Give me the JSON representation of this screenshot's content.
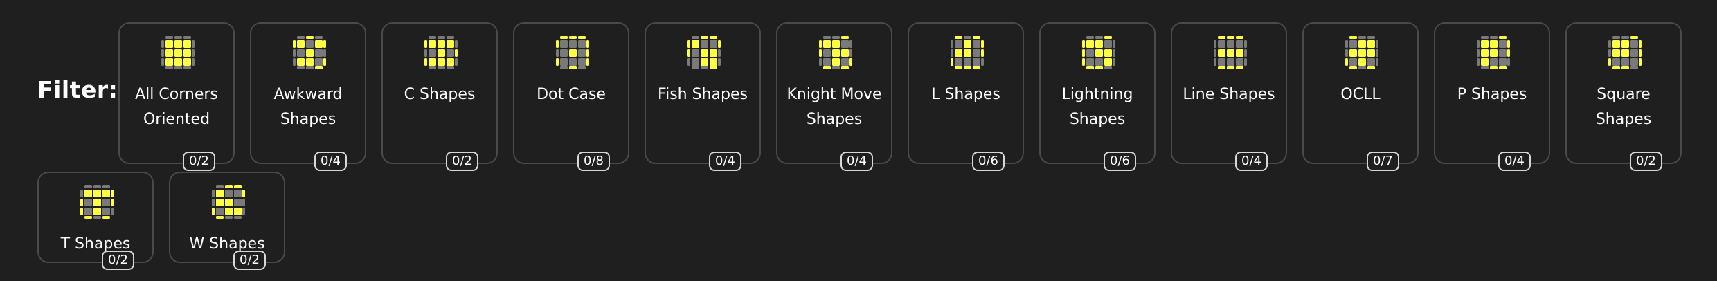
{
  "filter_label": "Filter:",
  "colors": {
    "top": "#ffff44",
    "off": "#7a7a7a",
    "background": "#1f1f1f"
  },
  "cards": [
    {
      "label": "All Corners Oriented",
      "count": "0/2",
      "top": [
        1,
        1,
        1,
        1,
        1,
        1,
        1,
        1,
        1
      ],
      "sides": {
        "t": [
          0,
          0,
          0
        ],
        "r": [
          0,
          0,
          0
        ],
        "b": [
          0,
          0,
          0
        ],
        "l": [
          0,
          0,
          0
        ]
      }
    },
    {
      "label": "Awkward Shapes",
      "count": "0/4",
      "top": [
        1,
        0,
        1,
        0,
        1,
        0,
        1,
        1,
        0
      ],
      "sides": {
        "t": [
          0,
          1,
          0
        ],
        "r": [
          1,
          0,
          1
        ],
        "b": [
          0,
          0,
          1
        ],
        "l": [
          1,
          0,
          0
        ]
      }
    },
    {
      "label": "C Shapes",
      "count": "0/2",
      "top": [
        1,
        1,
        1,
        0,
        1,
        0,
        1,
        1,
        1
      ],
      "sides": {
        "t": [
          0,
          0,
          0
        ],
        "r": [
          0,
          1,
          0
        ],
        "b": [
          0,
          0,
          0
        ],
        "l": [
          1,
          0,
          1
        ]
      }
    },
    {
      "label": "Dot Case",
      "count": "0/8",
      "top": [
        0,
        0,
        0,
        0,
        1,
        0,
        0,
        0,
        0
      ],
      "sides": {
        "t": [
          1,
          1,
          1
        ],
        "r": [
          1,
          1,
          1
        ],
        "b": [
          0,
          1,
          0
        ],
        "l": [
          1,
          0,
          1
        ]
      }
    },
    {
      "label": "Fish Shapes",
      "count": "0/4",
      "top": [
        1,
        0,
        0,
        0,
        1,
        1,
        0,
        1,
        1
      ],
      "sides": {
        "t": [
          0,
          1,
          1
        ],
        "r": [
          1,
          0,
          0
        ],
        "b": [
          0,
          0,
          1
        ],
        "l": [
          1,
          1,
          0
        ]
      }
    },
    {
      "label": "Knight Move Shapes",
      "count": "0/4",
      "top": [
        1,
        1,
        0,
        0,
        1,
        1,
        0,
        1,
        0
      ],
      "sides": {
        "t": [
          0,
          0,
          1
        ],
        "r": [
          0,
          0,
          1
        ],
        "b": [
          1,
          0,
          1
        ],
        "l": [
          1,
          1,
          0
        ]
      }
    },
    {
      "label": "L Shapes",
      "count": "0/6",
      "top": [
        0,
        1,
        0,
        1,
        1,
        0,
        0,
        0,
        0
      ],
      "sides": {
        "t": [
          1,
          0,
          1
        ],
        "r": [
          1,
          1,
          0
        ],
        "b": [
          1,
          1,
          1
        ],
        "l": [
          0,
          0,
          1
        ]
      }
    },
    {
      "label": "Lightning Shapes",
      "count": "0/6",
      "top": [
        1,
        1,
        0,
        0,
        1,
        1,
        0,
        0,
        1
      ],
      "sides": {
        "t": [
          0,
          0,
          1
        ],
        "r": [
          0,
          0,
          0
        ],
        "b": [
          1,
          1,
          0
        ],
        "l": [
          1,
          1,
          1
        ]
      }
    },
    {
      "label": "Line Shapes",
      "count": "0/4",
      "top": [
        0,
        0,
        0,
        1,
        1,
        1,
        0,
        0,
        0
      ],
      "sides": {
        "t": [
          1,
          1,
          1
        ],
        "r": [
          0,
          0,
          0
        ],
        "b": [
          1,
          1,
          1
        ],
        "l": [
          0,
          0,
          0
        ]
      }
    },
    {
      "label": "OCLL",
      "count": "0/7",
      "top": [
        0,
        1,
        1,
        1,
        1,
        1,
        0,
        1,
        0
      ],
      "sides": {
        "t": [
          1,
          0,
          0
        ],
        "r": [
          0,
          0,
          0
        ],
        "b": [
          1,
          0,
          1
        ],
        "l": [
          0,
          0,
          1
        ]
      }
    },
    {
      "label": "P Shapes",
      "count": "0/4",
      "top": [
        1,
        1,
        0,
        1,
        1,
        0,
        1,
        0,
        0
      ],
      "sides": {
        "t": [
          0,
          0,
          1
        ],
        "r": [
          1,
          1,
          0
        ],
        "b": [
          0,
          1,
          1
        ],
        "l": [
          0,
          0,
          0
        ]
      }
    },
    {
      "label": "Square Shapes",
      "count": "0/2",
      "top": [
        1,
        1,
        0,
        1,
        1,
        0,
        0,
        0,
        0
      ],
      "sides": {
        "t": [
          0,
          0,
          1
        ],
        "r": [
          1,
          1,
          1
        ],
        "b": [
          1,
          1,
          0
        ],
        "l": [
          0,
          0,
          1
        ]
      }
    },
    {
      "label": "T Shapes",
      "count": "0/2",
      "top": [
        1,
        1,
        1,
        0,
        1,
        0,
        0,
        1,
        0
      ],
      "sides": {
        "t": [
          0,
          0,
          0
        ],
        "r": [
          1,
          1,
          0
        ],
        "b": [
          1,
          0,
          1
        ],
        "l": [
          0,
          1,
          1
        ]
      }
    },
    {
      "label": "W Shapes",
      "count": "0/2",
      "top": [
        1,
        0,
        0,
        1,
        1,
        0,
        0,
        1,
        1
      ],
      "sides": {
        "t": [
          0,
          1,
          1
        ],
        "r": [
          1,
          0,
          0
        ],
        "b": [
          1,
          0,
          0
        ],
        "l": [
          0,
          0,
          1
        ]
      }
    }
  ]
}
